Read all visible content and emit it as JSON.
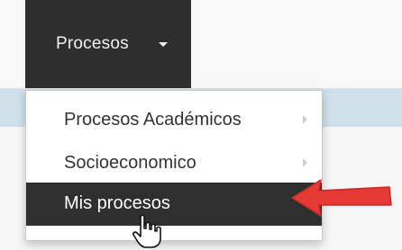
{
  "navbar": {
    "menu_label": "Procesos",
    "caret_icon": "caret-down-icon"
  },
  "dropdown": {
    "items": [
      {
        "label": "Procesos Académicos",
        "has_submenu": true,
        "icon": "chevron-right-icon"
      },
      {
        "label": "Socioeconomico",
        "has_submenu": true,
        "icon": "chevron-right-icon"
      },
      {
        "label": "Mis procesos",
        "has_submenu": false,
        "highlighted": true
      }
    ]
  },
  "annotations": {
    "arrow_icon": "red-arrow-icon",
    "arrow_color": "#e53935",
    "cursor_icon": "hand-pointer-icon"
  },
  "colors": {
    "navbar_dark": "#2e2e2e",
    "highlight": "#2f2f2f",
    "band": "#cfe0ea"
  }
}
